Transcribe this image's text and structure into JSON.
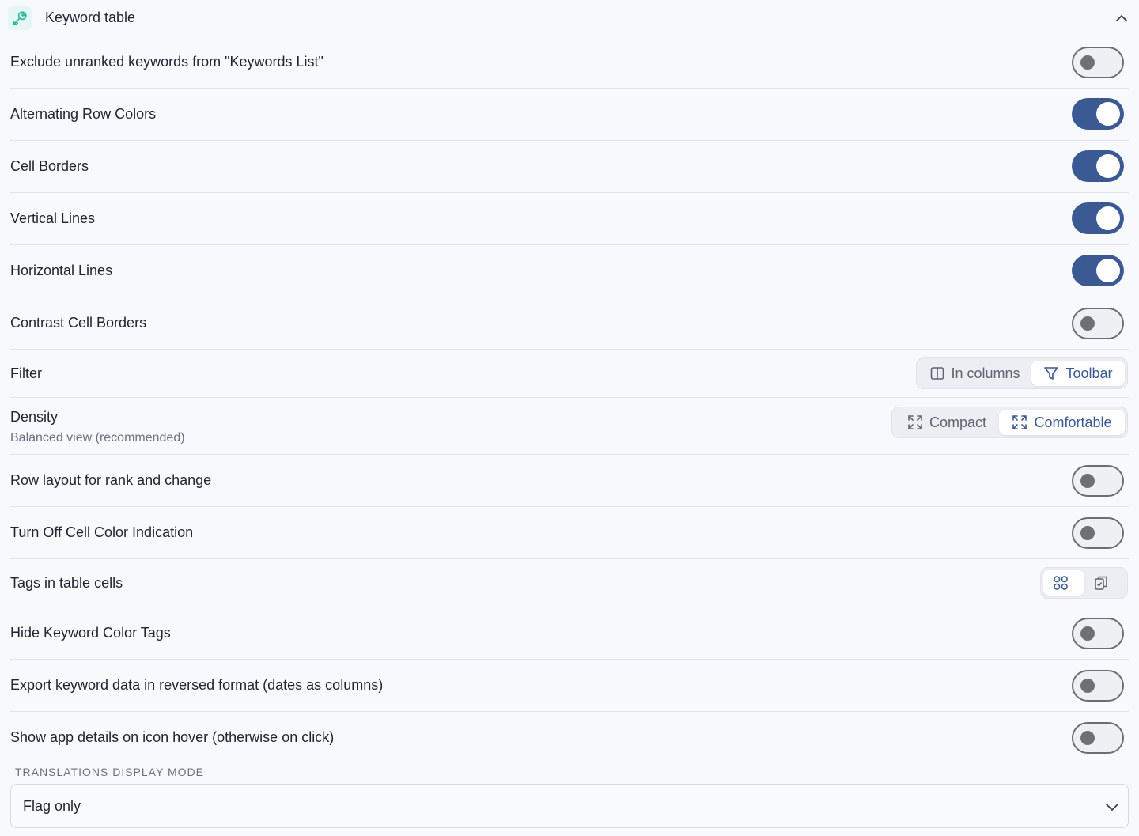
{
  "header": {
    "title": "Keyword table",
    "icon": "key-icon",
    "collapse_icon": "chevron-up-icon"
  },
  "colors": {
    "accent": "#3b5a94",
    "toggle_off_knob": "#6e7076",
    "header_icon_bg": "#e4f7f4",
    "header_icon_stroke": "#2bb5a0"
  },
  "settings": {
    "exclude_unranked": {
      "label": "Exclude unranked keywords from \"Keywords List\"",
      "on": false
    },
    "alternating_rows": {
      "label": "Alternating Row Colors",
      "on": true
    },
    "cell_borders": {
      "label": "Cell Borders",
      "on": true
    },
    "vertical_lines": {
      "label": "Vertical Lines",
      "on": true
    },
    "horizontal_lines": {
      "label": "Horizontal Lines",
      "on": true
    },
    "contrast_borders": {
      "label": "Contrast Cell Borders",
      "on": false
    },
    "filter": {
      "label": "Filter",
      "options": [
        {
          "label": "In columns",
          "icon": "columns-icon"
        },
        {
          "label": "Toolbar",
          "icon": "funnel-icon"
        }
      ],
      "selected": "Toolbar"
    },
    "density": {
      "label": "Density",
      "sublabel": "Balanced view (recommended)",
      "options": [
        {
          "label": "Compact",
          "icon": "expand-icon"
        },
        {
          "label": "Comfortable",
          "icon": "expand-icon"
        }
      ],
      "selected": "Comfortable"
    },
    "row_layout": {
      "label": "Row layout for rank and change",
      "on": false
    },
    "cell_color_off": {
      "label": "Turn Off Cell Color Indication",
      "on": false
    },
    "tags_in_cells": {
      "label": "Tags in table cells",
      "options": [
        {
          "icon": "grid-icon"
        },
        {
          "icon": "copy-tags-icon"
        }
      ],
      "selected_index": 0
    },
    "hide_color_tags": {
      "label": "Hide Keyword Color Tags",
      "on": false
    },
    "export_reversed": {
      "label": "Export keyword data in reversed format (dates as columns)",
      "on": false
    },
    "hover_details": {
      "label": "Show app details on icon hover (otherwise on click)",
      "on": false
    }
  },
  "translations": {
    "section_label": "TRANSLATIONS DISPLAY MODE",
    "selected": "Flag only",
    "icon": "chevron-down-icon"
  }
}
